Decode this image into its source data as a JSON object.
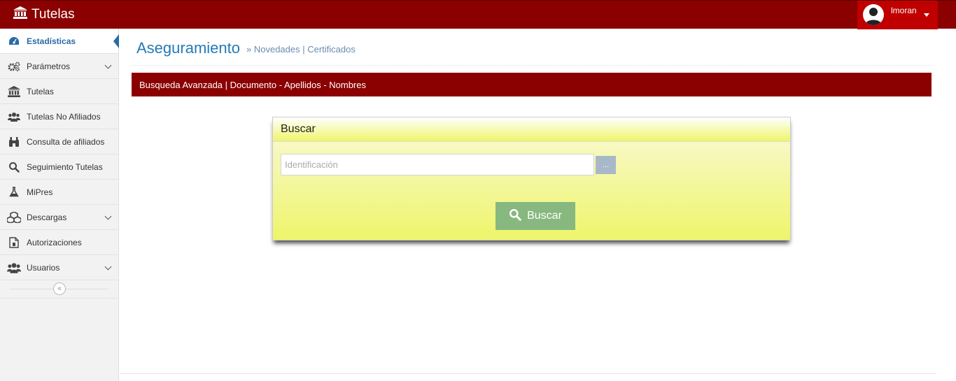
{
  "navbar": {
    "brand": "Tutelas",
    "user": "lmoran"
  },
  "sidebar": {
    "items": [
      {
        "label": "Estadísticas",
        "icon": "dashboard-icon"
      },
      {
        "label": "Parámetros",
        "icon": "gears-icon"
      },
      {
        "label": "Tutelas",
        "icon": "bank-icon"
      },
      {
        "label": "Tutelas No Afiliados",
        "icon": "users-icon"
      },
      {
        "label": "Consulta de afiliados",
        "icon": "binoculars-icon"
      },
      {
        "label": "Seguimiento Tutelas",
        "icon": "search-icon"
      },
      {
        "label": "MiPres",
        "icon": "flask-icon"
      },
      {
        "label": "Descargas",
        "icon": "cubes-icon"
      },
      {
        "label": "Autorizaciones",
        "icon": "file-icon"
      },
      {
        "label": "Usuarios",
        "icon": "users-icon"
      }
    ],
    "collapse_glyph": "«"
  },
  "header": {
    "title": "Aseguramiento",
    "subtitle": "» Novedades | Certificados"
  },
  "bar": {
    "text": "Busqueda Avanzada | Documento - Apellidos - Nombres"
  },
  "panel": {
    "title": "Buscar",
    "input_placeholder": "Identificación",
    "dots_label": "...",
    "search_label": "Buscar"
  },
  "colors": {
    "brand_red": "#8b0000",
    "user_red": "#c00000",
    "accent_blue": "#2679b5",
    "button_green": "#87b87f"
  }
}
